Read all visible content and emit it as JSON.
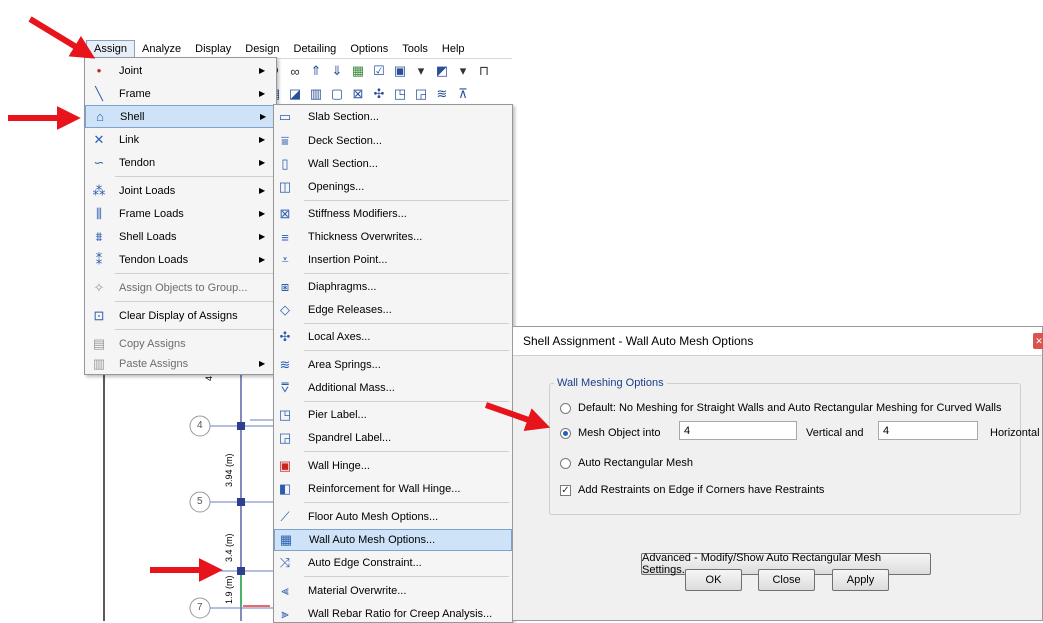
{
  "menubar": {
    "items": [
      "Assign",
      "Analyze",
      "Display",
      "Design",
      "Detailing",
      "Options",
      "Tools",
      "Help"
    ]
  },
  "assign_menu": {
    "items": [
      {
        "label": "Joint",
        "icon": "joint-icon",
        "submenu": true
      },
      {
        "label": "Frame",
        "icon": "frame-icon",
        "submenu": true
      },
      {
        "label": "Shell",
        "icon": "shell-icon",
        "submenu": true,
        "highlighted": true
      },
      {
        "label": "Link",
        "icon": "link-icon",
        "submenu": true
      },
      {
        "label": "Tendon",
        "icon": "tendon-icon",
        "submenu": true
      },
      {
        "label": "Joint Loads",
        "icon": "joint-loads-icon",
        "submenu": true
      },
      {
        "label": "Frame Loads",
        "icon": "frame-loads-icon",
        "submenu": true
      },
      {
        "label": "Shell Loads",
        "icon": "shell-loads-icon",
        "submenu": true
      },
      {
        "label": "Tendon Loads",
        "icon": "tendon-loads-icon",
        "submenu": true
      },
      {
        "label": "Assign Objects to Group...",
        "icon": "group-icon",
        "disabled": true
      },
      {
        "label": "Clear Display of Assigns",
        "icon": "clear-display-icon"
      },
      {
        "label": "Copy Assigns",
        "icon": "copy-icon",
        "disabled": true
      },
      {
        "label": "Paste Assigns",
        "icon": "paste-icon",
        "disabled": true,
        "submenu": true
      }
    ]
  },
  "shell_submenu": {
    "items": [
      {
        "label": "Slab Section...",
        "icon": "slab-section-icon"
      },
      {
        "label": "Deck Section...",
        "icon": "deck-section-icon"
      },
      {
        "label": "Wall Section...",
        "icon": "wall-section-icon"
      },
      {
        "label": "Openings...",
        "icon": "openings-icon"
      },
      {
        "label": "Stiffness Modifiers...",
        "icon": "stiffness-modifiers-icon"
      },
      {
        "label": "Thickness Overwrites...",
        "icon": "thickness-overwrites-icon"
      },
      {
        "label": "Insertion Point...",
        "icon": "insertion-point-icon"
      },
      {
        "label": "Diaphragms...",
        "icon": "diaphragms-icon"
      },
      {
        "label": "Edge Releases...",
        "icon": "edge-releases-icon"
      },
      {
        "label": "Local Axes...",
        "icon": "local-axes-icon"
      },
      {
        "label": "Area Springs...",
        "icon": "area-springs-icon"
      },
      {
        "label": "Additional Mass...",
        "icon": "additional-mass-icon"
      },
      {
        "label": "Pier Label...",
        "icon": "pier-label-icon"
      },
      {
        "label": "Spandrel Label...",
        "icon": "spandrel-label-icon"
      },
      {
        "label": "Wall Hinge...",
        "icon": "wall-hinge-icon"
      },
      {
        "label": "Reinforcement for Wall Hinge...",
        "icon": "reinforcement-icon"
      },
      {
        "label": "Floor Auto Mesh Options...",
        "icon": "floor-mesh-icon"
      },
      {
        "label": "Wall Auto Mesh Options...",
        "icon": "wall-mesh-icon",
        "highlighted": true
      },
      {
        "label": "Auto Edge Constraint...",
        "icon": "edge-constraint-icon"
      },
      {
        "label": "Material Overwrite...",
        "icon": "material-overwrite-icon"
      },
      {
        "label": "Wall Rebar Ratio for Creep Analysis...",
        "icon": "rebar-ratio-icon"
      }
    ]
  },
  "canvas": {
    "story_labels": [
      "4",
      "5",
      "7"
    ],
    "dimension_labels": [
      "4.9",
      "3.94 (m)",
      "3.4 (m)",
      "1.9 (m)"
    ]
  },
  "dialog": {
    "title": "Shell Assignment - Wall Auto Mesh Options",
    "group_title": "Wall Meshing Options",
    "option_default": "Default:  No Meshing for Straight Walls and Auto Rectangular Meshing for Curved Walls",
    "option_mesh": "Mesh Object into",
    "vertical_value": "4",
    "vertical_label": "Vertical  and",
    "horizontal_value": "4",
    "horizontal_label": "Horizontal",
    "option_auto": "Auto Rectangular Mesh",
    "checkbox_label": "Add Restraints on Edge if Corners have Restraints",
    "advanced_button": "Advanced - Modify/Show Auto Rectangular Mesh Settings...",
    "ok_button": "OK",
    "close_button": "Close",
    "apply_button": "Apply"
  },
  "colors": {
    "arrow": "#e8141b",
    "highlight": "#cfe3f8",
    "joint": "#2e3f8f"
  }
}
